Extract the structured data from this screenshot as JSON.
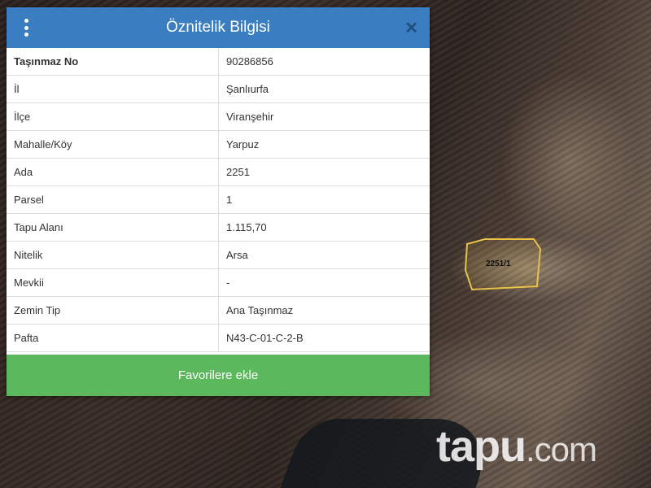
{
  "dialog": {
    "title": "Öznitelik Bilgisi",
    "close_label": "✕",
    "rows": [
      {
        "label": "Taşınmaz No",
        "value": "90286856"
      },
      {
        "label": "İl",
        "value": "Şanlıurfa"
      },
      {
        "label": "İlçe",
        "value": "Viranşehir"
      },
      {
        "label": "Mahalle/Köy",
        "value": "Yarpuz"
      },
      {
        "label": "Ada",
        "value": "2251"
      },
      {
        "label": "Parsel",
        "value": "1"
      },
      {
        "label": "Tapu Alanı",
        "value": "1.115,70"
      },
      {
        "label": "Nitelik",
        "value": "Arsa"
      },
      {
        "label": "Mevkii",
        "value": "-"
      },
      {
        "label": "Zemin Tip",
        "value": "Ana Taşınmaz"
      },
      {
        "label": "Pafta",
        "value": "N43-C-01-C-2-B"
      }
    ],
    "favorite_button": "Favorilere ekle"
  },
  "map": {
    "parcel_label": "2251/1",
    "watermark_main": "tapu",
    "watermark_suffix": ".com"
  },
  "colors": {
    "header": "#3a7dc0",
    "button": "#5cb85c",
    "parcel_outline": "#e8c14a"
  }
}
